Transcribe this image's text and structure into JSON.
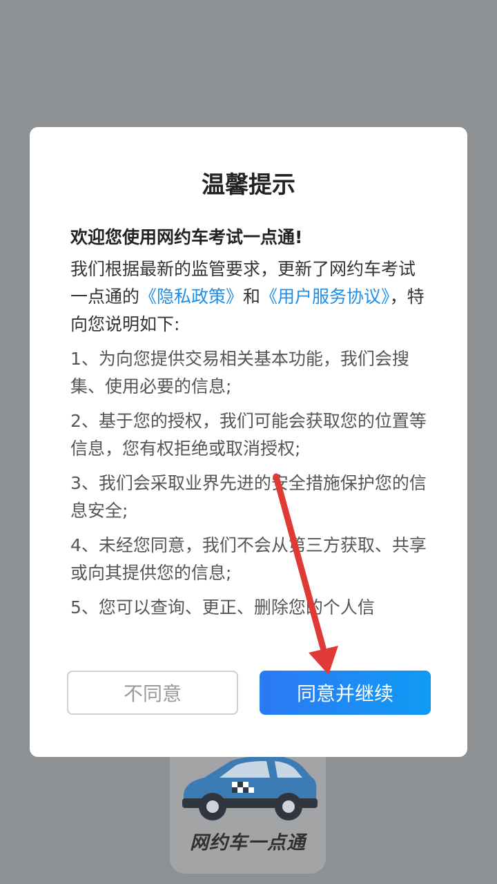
{
  "background": {
    "logo_text": "网约车一点通"
  },
  "dialog": {
    "title": "温馨提示",
    "welcome": "欢迎您使用网约车考试一点通!",
    "intro_part1": "我们根据最新的监管要求，更新了网约车考试一点通的",
    "privacy_link": "《隐私政策》",
    "intro_and": "和",
    "service_link": "《用户服务协议》",
    "intro_part2": "，特向您说明如下:",
    "items": [
      "1、为向您提供交易相关基本功能，我们会搜集、使用必要的信息;",
      "2、基于您的授权，我们可能会获取您的位置等信息，您有权拒绝或取消授权;",
      "3、我们会采取业界先进的安全措施保护您的信息安全;",
      "4、未经您同意，我们不会从第三方获取、共享或向其提供您的信息;",
      "5、您可以查询、更正、删除您的个人信"
    ],
    "disagree_label": "不同意",
    "agree_label": "同意并继续"
  },
  "colors": {
    "link": "#1e8ee8",
    "agree_gradient_start": "#2d79f3",
    "agree_gradient_end": "#0f9bf5",
    "annotation_arrow": "#e03a36",
    "overlay": "#8e9193"
  },
  "icons": {
    "background_logo": "taxi-car-icon",
    "annotation": "red-arrow-pointer"
  }
}
